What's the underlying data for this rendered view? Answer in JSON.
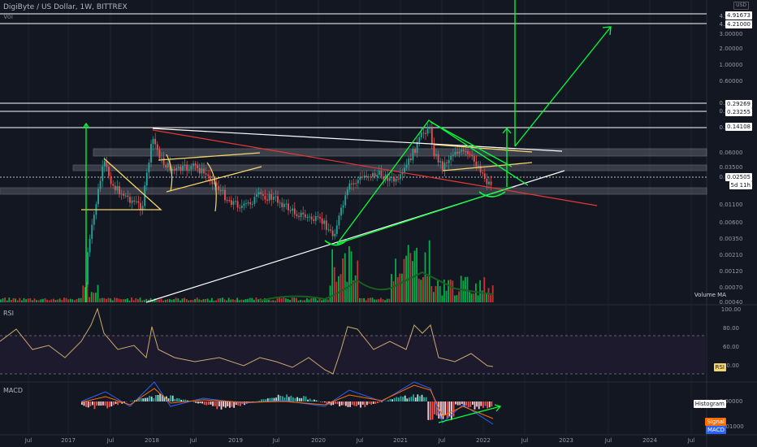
{
  "header": {
    "title": "DigiByte / US Dollar, 1W, BITTREX",
    "sub": "Vol",
    "currency": "USD"
  },
  "colors": {
    "bg": "#131722",
    "grid": "#1e222d",
    "up": "#26a69a",
    "down": "#ef5350",
    "green_line": "#00ff3a",
    "white_line": "#ffffff",
    "red_line": "#e53935",
    "yellow_line": "#f5d66b",
    "rsi_line": "#c9a96e",
    "macd_line": "#2962ff",
    "signal_line": "#ff6d00"
  },
  "chart_data": [
    {
      "type": "candlestick",
      "title": "DigiByte / US Dollar, 1W, BITTREX",
      "yscale": "log",
      "y_ticks": [
        "4.91673",
        "4.21000",
        "3.00000",
        "2.00000",
        "1.00000",
        "0.60000",
        "0.29269",
        "0.23255",
        "0.14108",
        "0.06000",
        "0.03500",
        "0.02505",
        "0.01100",
        "0.00600",
        "0.00350",
        "0.00210",
        "0.00120",
        "0.00070",
        "0.00040"
      ],
      "highlighted_levels": [
        "4.91673",
        "4.21000",
        "0.29269",
        "0.23255",
        "0.14108",
        "0.02505"
      ],
      "countdown": "5d 11h",
      "x_ticks": [
        "Jul",
        "2017",
        "Jul",
        "2018",
        "Jul",
        "2019",
        "Jul",
        "2020",
        "Jul",
        "2021",
        "Jul",
        "2022",
        "Jul",
        "2023",
        "Jul",
        "2024",
        "Jul"
      ],
      "series": [
        {
          "name": "Volume MA",
          "label": "Volume MA"
        }
      ]
    },
    {
      "type": "line",
      "title": "RSI",
      "y_ticks": [
        "100.00",
        "80.00",
        "60.00",
        "40.00"
      ],
      "levels": [
        70,
        30
      ],
      "series": [
        {
          "name": "RSI",
          "label": "RSI"
        }
      ]
    },
    {
      "type": "bar",
      "title": "MACD",
      "y_ticks": [
        "0.00000",
        "-0.01000"
      ],
      "series": [
        {
          "name": "Histogram",
          "label": "Histogram"
        },
        {
          "name": "Signal",
          "label": "Signal"
        },
        {
          "name": "MACD",
          "label": "MACD"
        }
      ]
    }
  ]
}
